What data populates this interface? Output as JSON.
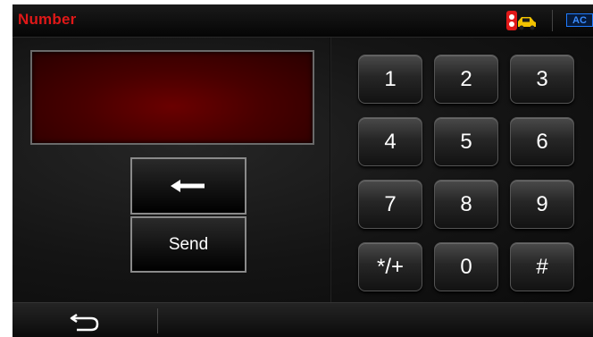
{
  "header": {
    "title": "Number",
    "status": {
      "car_icon": "car-warning-icon",
      "ac_label": "AC",
      "ac_color": "#1f7bff"
    }
  },
  "display": {
    "value": ""
  },
  "controls": {
    "backspace_icon": "left-arrow-icon",
    "send_label": "Send"
  },
  "keypad": [
    {
      "name": "key-1",
      "label": "1"
    },
    {
      "name": "key-2",
      "label": "2"
    },
    {
      "name": "key-3",
      "label": "3"
    },
    {
      "name": "key-4",
      "label": "4"
    },
    {
      "name": "key-5",
      "label": "5"
    },
    {
      "name": "key-6",
      "label": "6"
    },
    {
      "name": "key-7",
      "label": "7"
    },
    {
      "name": "key-8",
      "label": "8"
    },
    {
      "name": "key-9",
      "label": "9"
    },
    {
      "name": "key-star-plus",
      "label": "*/+"
    },
    {
      "name": "key-0",
      "label": "0"
    },
    {
      "name": "key-hash",
      "label": "#"
    }
  ],
  "footer": {
    "return_icon": "return-arrow-icon"
  },
  "colors": {
    "title": "#e01818",
    "display_bg": "#5a0000",
    "accent": "#1f7bff"
  }
}
